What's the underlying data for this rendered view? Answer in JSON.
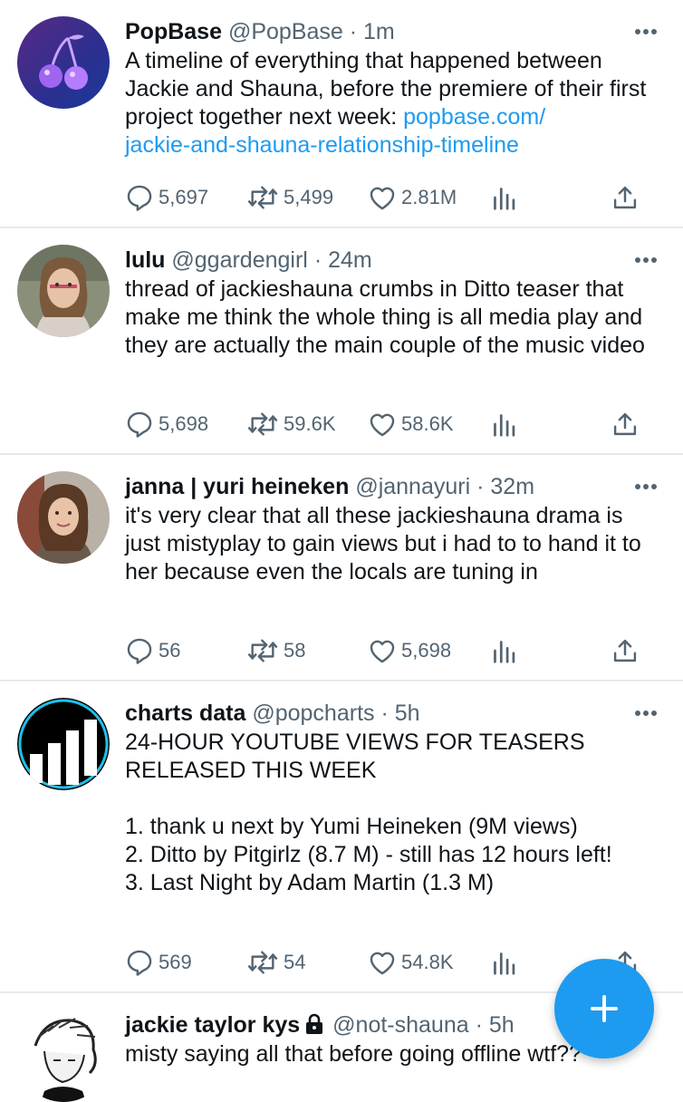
{
  "tweets": [
    {
      "name": "PopBase",
      "handle": "@PopBase",
      "time": "· 1m",
      "text": "A timeline of everything that happened between Jackie and Shauna, before the premiere of their first project together next week: ",
      "link": "popbase.com/\njackie-and-shauna-relationship-timeline",
      "replies": "5,697",
      "retweets": "5,499",
      "likes": "2.81M",
      "avatar_icon": "cherry-logo-icon"
    },
    {
      "name": "lulu",
      "handle": "@ggardengirl",
      "time": "· 24m",
      "text": "thread of jackieshauna crumbs in Ditto teaser that make me think the whole thing is all media play and they are actually the main couple of the music video",
      "replies": "5,698",
      "retweets": "59.6K",
      "likes": "58.6K",
      "avatar_icon": "profile-photo"
    },
    {
      "name": "janna | yuri heineken",
      "handle": "@jannayuri",
      "time": "· 32m",
      "text": "it's very clear that all these jackieshauna drama is just mistyplay to gain views but i had to to hand it to her because even the locals are tuning in",
      "replies": "56",
      "retweets": "58",
      "likes": "5,698",
      "avatar_icon": "profile-photo"
    },
    {
      "name": "charts data",
      "handle": "@popcharts",
      "time": "· 5h",
      "text": "24-HOUR YOUTUBE VIEWS FOR TEASERS RELEASED THIS WEEK\n\n1. thank u next by Yumi Heineken (9M views)\n2. Ditto by Pitgirlz (8.7 M) - still has 12 hours left!\n3. Last Night by Adam Martin (1.3 M)",
      "replies": "569",
      "retweets": "54",
      "likes": "54.8K",
      "avatar_icon": "bar-chart-logo-icon"
    },
    {
      "name": "jackie taylor kys",
      "handle": "@not-shauna",
      "time": "· 5h",
      "text": "misty saying all that before going offline wtf??",
      "avatar_icon": "sketch-profile-photo"
    }
  ],
  "colors": {
    "accent": "#1d9bf0",
    "text": "#0f1419",
    "muted": "#536471",
    "divider": "#e7e9ea"
  },
  "icons": [
    "reply-icon",
    "retweet-icon",
    "like-icon",
    "analytics-icon",
    "share-icon",
    "more-icon",
    "lock-icon",
    "compose-plus-icon"
  ]
}
